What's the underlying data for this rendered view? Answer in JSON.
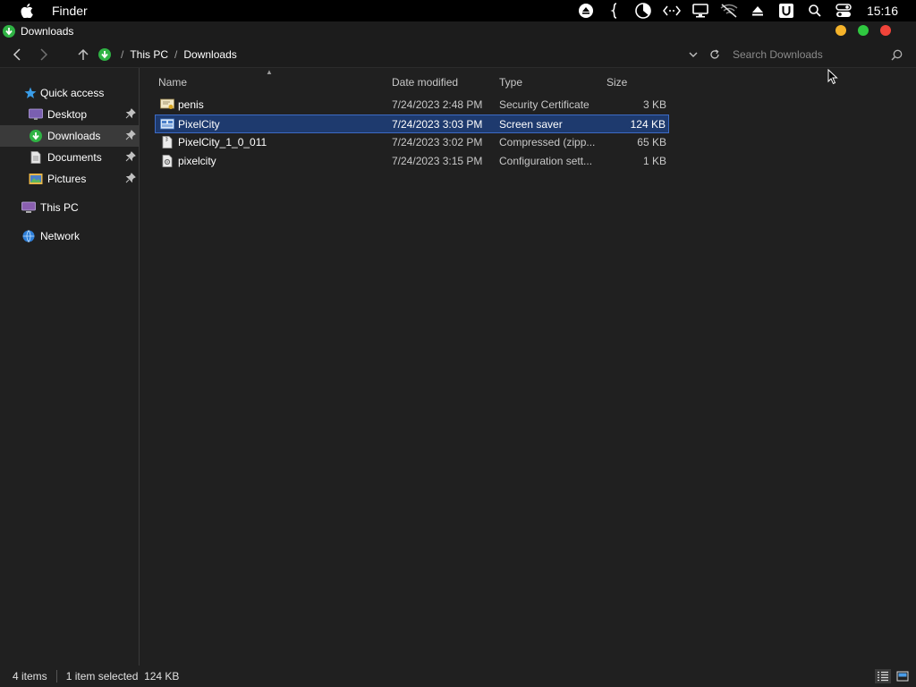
{
  "menubar": {
    "app_name": "Finder",
    "clock": "15:16"
  },
  "window": {
    "title": "Downloads",
    "traffic_colors": [
      "#f5b32a",
      "#2fc840",
      "#f0443a"
    ]
  },
  "navbar": {
    "breadcrumb": [
      "This PC",
      "Downloads"
    ],
    "search_placeholder": "Search Downloads"
  },
  "sidebar": {
    "items": [
      {
        "label": "Quick access",
        "icon": "star-icon"
      },
      {
        "label": "Desktop",
        "icon": "desktop-folder-icon",
        "pinned": true
      },
      {
        "label": "Downloads",
        "icon": "download-icon",
        "pinned": true,
        "active": true
      },
      {
        "label": "Documents",
        "icon": "document-icon",
        "pinned": true
      },
      {
        "label": "Pictures",
        "icon": "pictures-icon",
        "pinned": true
      },
      {
        "label": "This PC",
        "icon": "computer-icon"
      },
      {
        "label": "Network",
        "icon": "network-icon"
      }
    ]
  },
  "columns": {
    "name": "Name",
    "date": "Date modified",
    "type": "Type",
    "size": "Size"
  },
  "files": [
    {
      "name": "penis",
      "date": "7/24/2023 2:48 PM",
      "type": "Security Certificate",
      "size": "3 KB",
      "icon": "certificate-icon",
      "selected": false
    },
    {
      "name": "PixelCity",
      "date": "7/24/2023 3:03 PM",
      "type": "Screen saver",
      "size": "124 KB",
      "icon": "screensaver-icon",
      "selected": true
    },
    {
      "name": "PixelCity_1_0_011",
      "date": "7/24/2023 3:02 PM",
      "type": "Compressed (zipp...",
      "size": "65 KB",
      "icon": "zip-icon",
      "selected": false
    },
    {
      "name": "pixelcity",
      "date": "7/24/2023 3:15 PM",
      "type": "Configuration sett...",
      "size": "1 KB",
      "icon": "config-file-icon",
      "selected": false
    }
  ],
  "status": {
    "item_count": "4 items",
    "selection": "1 item selected  124 KB"
  }
}
